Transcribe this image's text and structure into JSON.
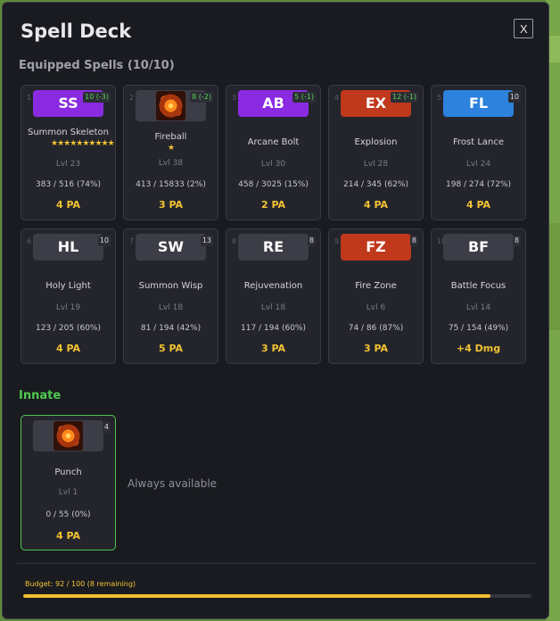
{
  "dialog": {
    "title": "Spell Deck",
    "close_label": "X"
  },
  "equipped": {
    "heading": "Equipped Spells (10/10)",
    "cards": [
      {
        "slot": "1",
        "cost": "10 (-3)",
        "cost_color": "green",
        "abbr": "SS",
        "color": "#8a2be2",
        "name": "Summon Skeleton",
        "stars": "★★★★★★★★★★",
        "level": "Lvl 23",
        "xp": "383 / 516 (74%)",
        "pa": "4 PA",
        "icon": ""
      },
      {
        "slot": "2",
        "cost": "8 (-2)",
        "cost_color": "green",
        "abbr": "",
        "color": "",
        "name": "Fireball",
        "stars": "★",
        "level": "Lvl 38",
        "xp": "413 / 15833 (2%)",
        "pa": "3 PA",
        "icon": "fireball-icon"
      },
      {
        "slot": "3",
        "cost": "5 (-1)",
        "cost_color": "green",
        "abbr": "AB",
        "color": "#8a2be2",
        "name": "Arcane Bolt",
        "stars": "",
        "level": "Lvl 30",
        "xp": "458 / 3025 (15%)",
        "pa": "2 PA",
        "icon": ""
      },
      {
        "slot": "4",
        "cost": "12 (-1)",
        "cost_color": "green",
        "abbr": "EX",
        "color": "#c0391c",
        "name": "Explosion",
        "stars": "",
        "level": "Lvl 28",
        "xp": "214 / 345 (62%)",
        "pa": "4 PA",
        "icon": ""
      },
      {
        "slot": "5",
        "cost": "10",
        "cost_color": "white",
        "abbr": "FL",
        "color": "#2c82dc",
        "name": "Frost Lance",
        "stars": "",
        "level": "Lvl 24",
        "xp": "198 / 274 (72%)",
        "pa": "4 PA",
        "icon": ""
      },
      {
        "slot": "6",
        "cost": "10",
        "cost_color": "white",
        "abbr": "HL",
        "color": "#3c3d46",
        "name": "Holy Light",
        "stars": "",
        "level": "Lvl 19",
        "xp": "123 / 205 (60%)",
        "pa": "4 PA",
        "icon": ""
      },
      {
        "slot": "7",
        "cost": "13",
        "cost_color": "white",
        "abbr": "SW",
        "color": "#3c3d46",
        "name": "Summon Wisp",
        "stars": "",
        "level": "Lvl 18",
        "xp": "81 / 194 (42%)",
        "pa": "5 PA",
        "icon": ""
      },
      {
        "slot": "8",
        "cost": "8",
        "cost_color": "white",
        "abbr": "RE",
        "color": "#3c3d46",
        "name": "Rejuvenation",
        "stars": "",
        "level": "Lvl 18",
        "xp": "117 / 194 (60%)",
        "pa": "3 PA",
        "icon": ""
      },
      {
        "slot": "9",
        "cost": "8",
        "cost_color": "white",
        "abbr": "FZ",
        "color": "#c0391c",
        "name": "Fire Zone",
        "stars": "",
        "level": "Lvl 6",
        "xp": "74 / 86 (87%)",
        "pa": "3 PA",
        "icon": ""
      },
      {
        "slot": "10",
        "cost": "8",
        "cost_color": "white",
        "abbr": "BF",
        "color": "#3c3d46",
        "name": "Battle Focus",
        "stars": "",
        "level": "Lvl 14",
        "xp": "75 / 154 (49%)",
        "pa": "+4 Dmg",
        "icon": ""
      }
    ]
  },
  "innate": {
    "heading": "Innate",
    "card": {
      "cost": "4",
      "name": "Punch",
      "level": "Lvl 1",
      "xp": "0 / 55 (0%)",
      "pa": "4 PA",
      "icon": "punch-icon"
    },
    "note": "Always available"
  },
  "budget": {
    "label": "Budget: 92 / 100  (8 remaining)",
    "fraction": 0.92
  }
}
